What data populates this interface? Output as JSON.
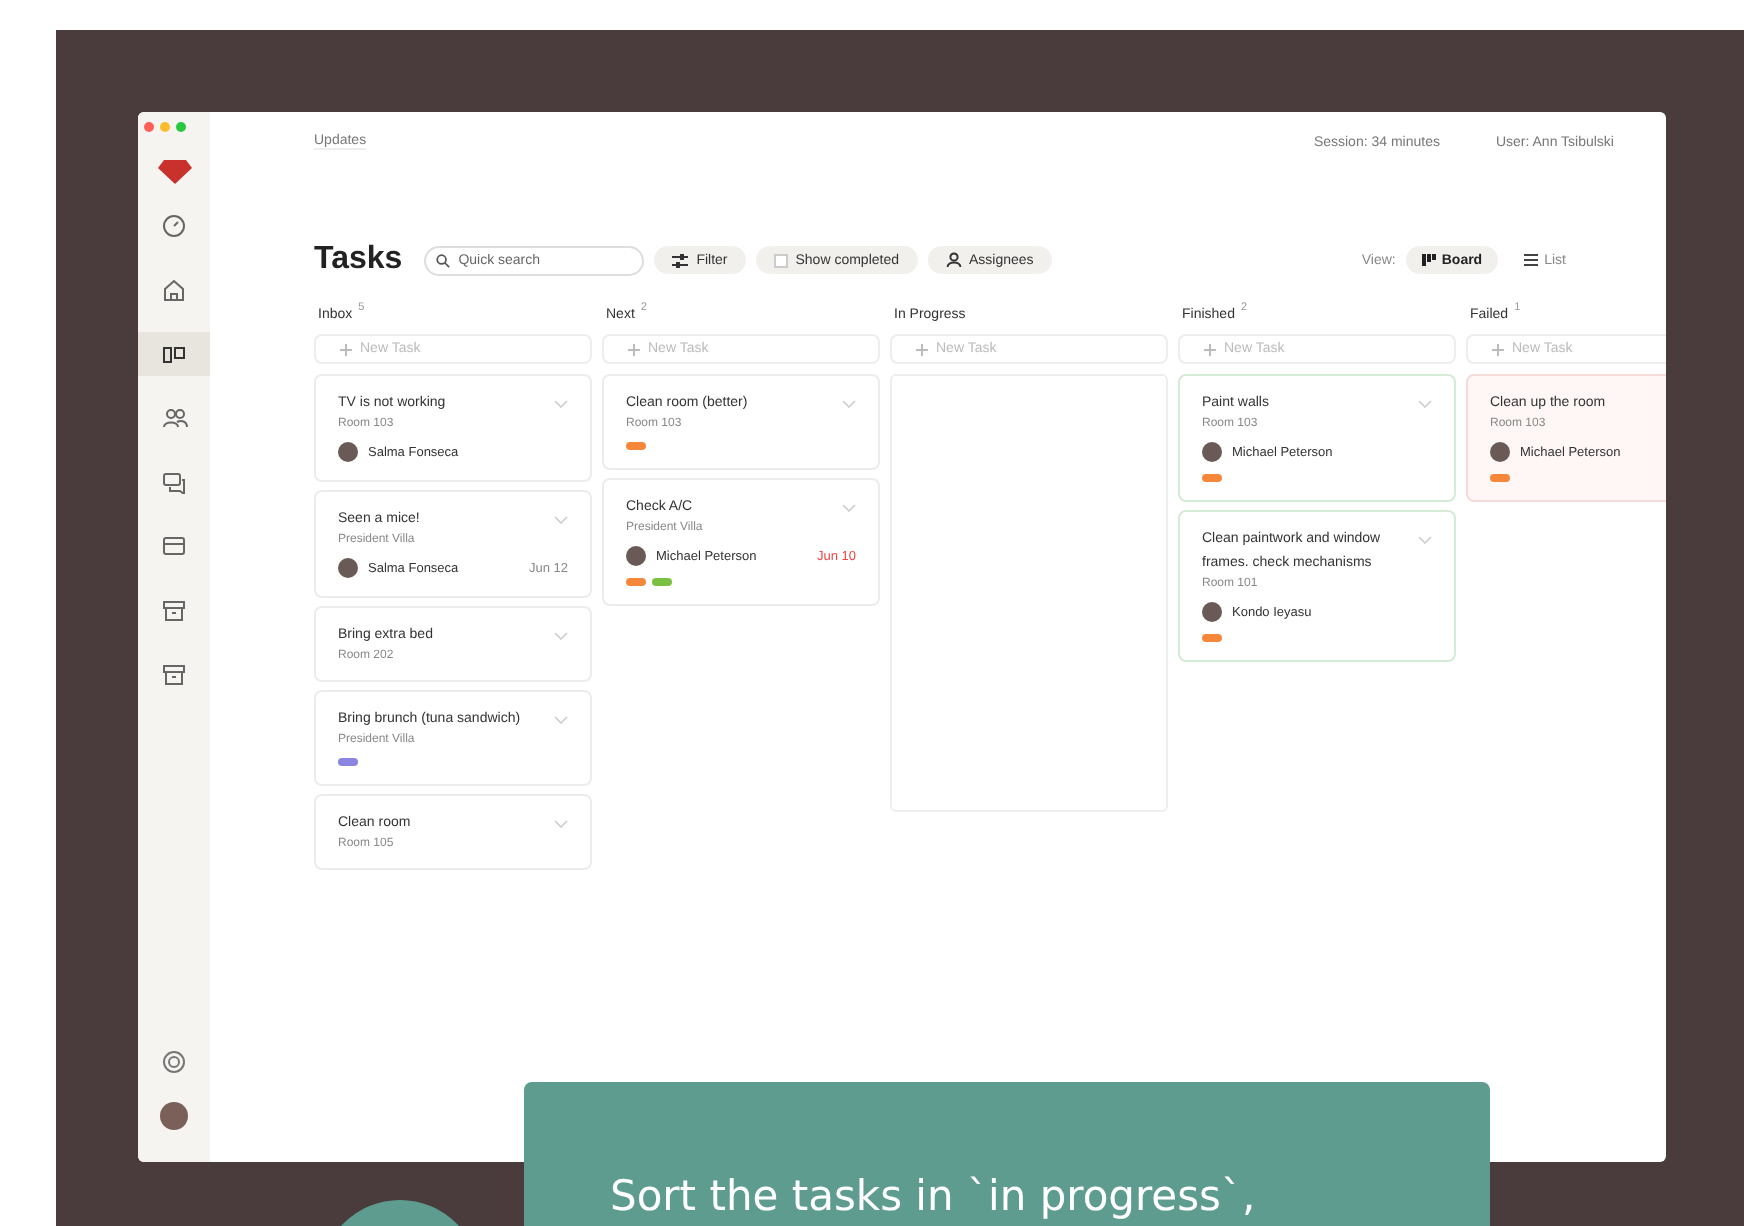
{
  "sidebar": {
    "items": [
      {
        "kind": "clock",
        "selected": false
      },
      {
        "kind": "home",
        "selected": false
      },
      {
        "kind": "board",
        "selected": true
      },
      {
        "kind": "people",
        "selected": false
      },
      {
        "kind": "chat",
        "selected": false
      },
      {
        "kind": "card",
        "selected": false
      },
      {
        "kind": "archive",
        "selected": false
      },
      {
        "kind": "archive",
        "selected": false
      }
    ]
  },
  "header": {
    "updates": "Updates",
    "session": "Session: 34 minutes",
    "user": "User: Ann Tsibulski"
  },
  "title": "Tasks",
  "search": {
    "placeholder": "Quick search"
  },
  "filters": [
    {
      "kind": "filter",
      "label": "Filter"
    },
    {
      "kind": "checkbox",
      "label": "Show completed",
      "checked": false
    },
    {
      "kind": "assignees",
      "label": "Assignees"
    }
  ],
  "view": {
    "label": "View:",
    "options": [
      {
        "kind": "board",
        "label": "Board",
        "selected": true
      },
      {
        "kind": "list",
        "label": "List",
        "selected": false
      }
    ]
  },
  "columns": [
    {
      "name": "Inbox",
      "count": "5",
      "new_task": "New Task",
      "cards": [
        {
          "title": "TV is not working",
          "subtitle": "Room 103",
          "assignee": "Salma Fonseca"
        },
        {
          "title": "Seen a mice!",
          "subtitle": "President Villa",
          "assignee": "Salma Fonseca",
          "date": "Jun 12",
          "overdue": false
        },
        {
          "title": "Bring extra bed",
          "subtitle": "Room 202"
        },
        {
          "title": "Bring brunch (tuna sandwich)",
          "subtitle": "President Villa",
          "labels": [
            {
              "color": "#8a86e0"
            }
          ]
        },
        {
          "title": "Clean room",
          "subtitle": "Room 105"
        }
      ]
    },
    {
      "name": "Next",
      "count": "2",
      "new_task": "New Task",
      "cards": [
        {
          "title": "Clean room (better)",
          "subtitle": "Room 103",
          "labels": [
            {
              "color": "#f5873a"
            }
          ]
        },
        {
          "title": "Check A/C",
          "subtitle": "President Villa",
          "assignee": "Michael Peterson",
          "date": "Jun 10",
          "overdue": true,
          "labels": [
            {
              "color": "#f5873a"
            },
            {
              "color": "#7ac143"
            }
          ]
        }
      ]
    },
    {
      "name": "In Progress",
      "new_task": "New Task"
    },
    {
      "name": "Finished",
      "count": "2",
      "kind": "finished",
      "new_task": "New Task",
      "cards": [
        {
          "title": "Paint walls",
          "subtitle": "Room 103",
          "assignee": "Michael Peterson",
          "labels": [
            {
              "color": "#f5873a"
            }
          ]
        },
        {
          "title": "Clean paintwork and window frames. check mechanisms",
          "subtitle": "Room 101",
          "assignee": "Kondo Ieyasu",
          "labels": [
            {
              "color": "#f5873a"
            }
          ]
        }
      ]
    },
    {
      "name": "Failed",
      "count": "1",
      "kind": "failed",
      "new_task": "New Task",
      "cards": [
        {
          "title": "Clean up the room",
          "subtitle": "Room 103",
          "assignee": "Michael Peterson",
          "labels": [
            {
              "color": "#f5873a"
            }
          ]
        }
      ]
    }
  ],
  "tooltip": {
    "text": "Sort the tasks in `in progress`,"
  }
}
